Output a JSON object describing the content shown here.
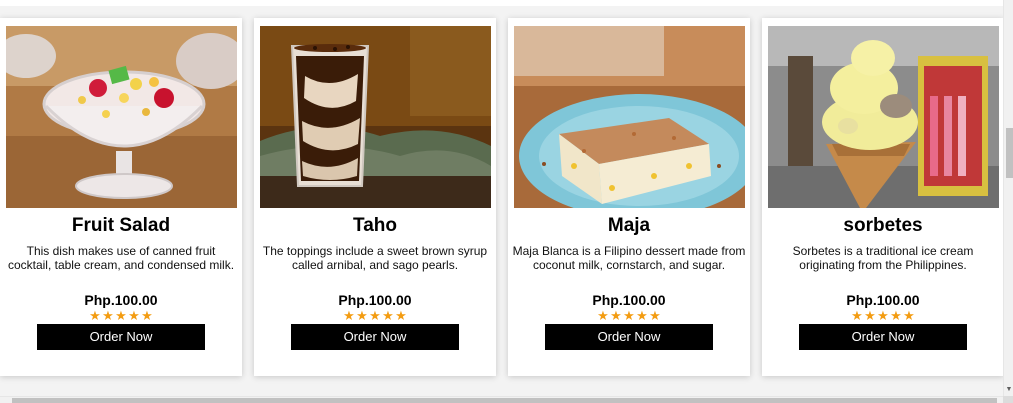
{
  "products": [
    {
      "name": "Fruit Salad",
      "description": "This dish makes use of canned fruit cocktail, table cream, and condensed milk.",
      "price": "Php.100.00",
      "rating": 5,
      "button_label": "Order Now",
      "image": "fruit-salad-image"
    },
    {
      "name": "Taho",
      "description": "The toppings include a sweet brown syrup called arnibal, and sago pearls.",
      "price": "Php.100.00",
      "rating": 5,
      "button_label": "Order Now",
      "image": "taho-image"
    },
    {
      "name": "Maja",
      "description": "Maja Blanca is a Filipino dessert made from coconut milk, cornstarch, and sugar.",
      "price": "Php.100.00",
      "rating": 5,
      "button_label": "Order Now",
      "image": "maja-image"
    },
    {
      "name": "sorbetes",
      "description": "Sorbetes is a traditional ice cream originating from the Philippines.",
      "price": "Php.100.00",
      "rating": 5,
      "button_label": "Order Now",
      "image": "sorbetes-image"
    }
  ],
  "colors": {
    "star": "#f39c12",
    "button_bg": "#000000",
    "button_text": "#ffffff",
    "card_bg": "#ffffff",
    "page_bg": "#f3f3f3"
  },
  "icons": {
    "star": "star-icon",
    "scroll_down": "chevron-down-icon"
  }
}
